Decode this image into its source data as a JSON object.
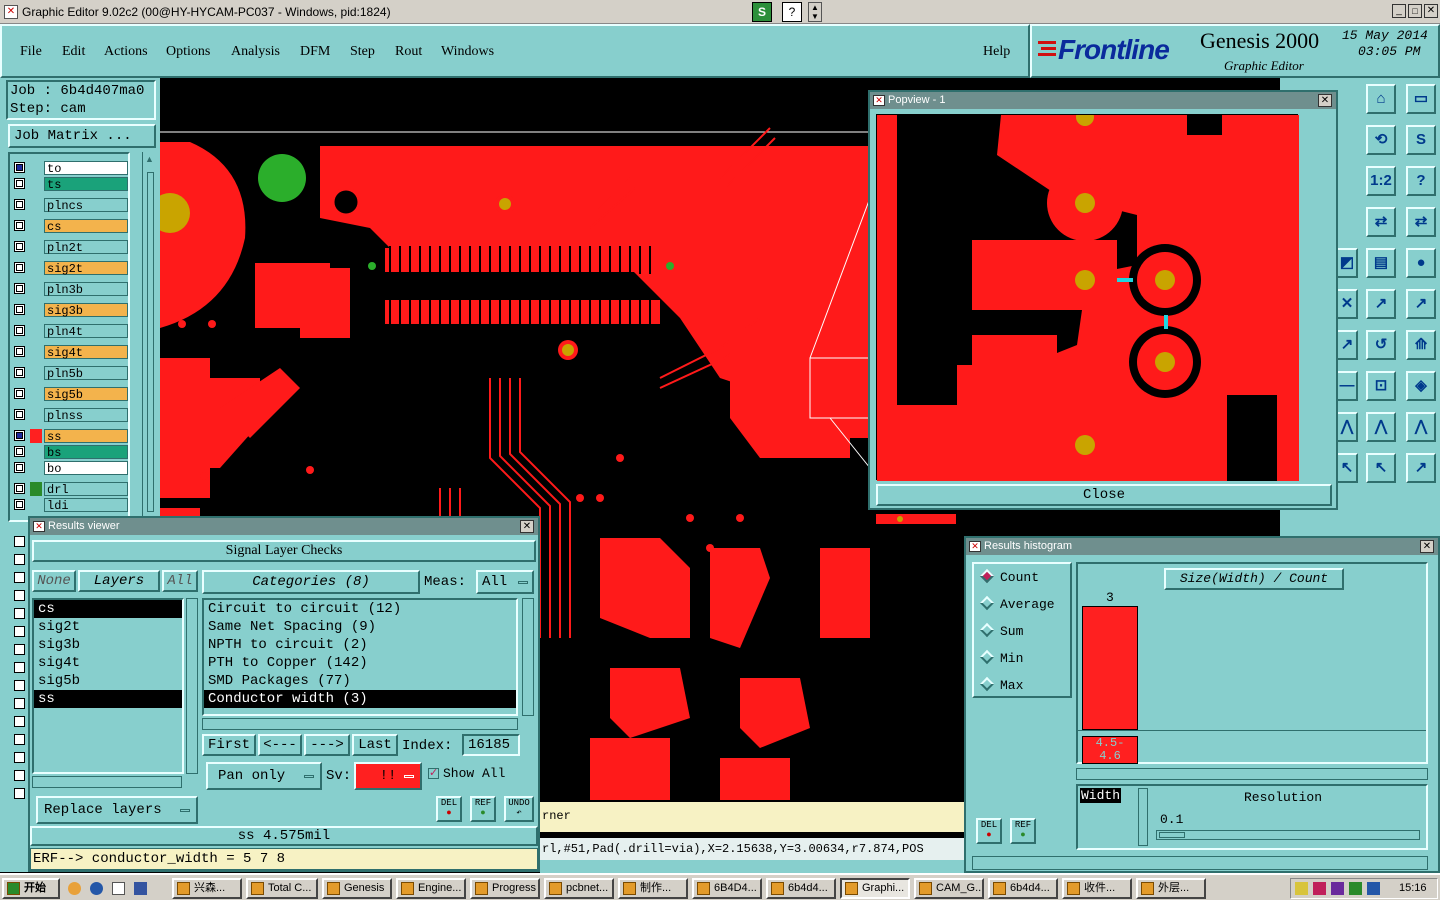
{
  "window": {
    "title": "Graphic Editor 9.02c2 (00@HY-HYCAM-PC037 - Windows, pid:1824)"
  },
  "menu": {
    "items": [
      "File",
      "Edit",
      "Actions",
      "Options",
      "Analysis",
      "DFM",
      "Step",
      "Rout",
      "Windows"
    ],
    "help": "Help"
  },
  "brand": {
    "logo": "Frontline",
    "product": "Genesis 2000",
    "subtitle": "Graphic Editor",
    "date": "15 May 2014",
    "time": "03:05 PM"
  },
  "job": {
    "job_label": "Job  : 6b4d407ma0",
    "step_label": "Step: cam",
    "matrix_button": "Job Matrix ..."
  },
  "layers": [
    {
      "name": "to",
      "color": "#ffffff",
      "checked": true
    },
    {
      "name": "ts",
      "color": "#1aa27a",
      "checked": false
    },
    {
      "name": "plncs",
      "color": "#87cfcd",
      "checked": false
    },
    {
      "name": "cs",
      "color": "#f3b34c",
      "checked": false
    },
    {
      "name": "pln2t",
      "color": "#87cfcd",
      "checked": false
    },
    {
      "name": "sig2t",
      "color": "#f3b34c",
      "checked": false
    },
    {
      "name": "pln3b",
      "color": "#87cfcd",
      "checked": false
    },
    {
      "name": "sig3b",
      "color": "#f3b34c",
      "checked": false
    },
    {
      "name": "pln4t",
      "color": "#87cfcd",
      "checked": false
    },
    {
      "name": "sig4t",
      "color": "#f3b34c",
      "checked": false
    },
    {
      "name": "pln5b",
      "color": "#87cfcd",
      "checked": false
    },
    {
      "name": "sig5b",
      "color": "#f3b34c",
      "checked": false
    },
    {
      "name": "plnss",
      "color": "#87cfcd",
      "checked": false
    },
    {
      "name": "ss",
      "color": "#f3b34c",
      "checked": true
    },
    {
      "name": "bs",
      "color": "#1aa27a",
      "checked": false
    },
    {
      "name": "bo",
      "color": "#ffffff",
      "checked": false
    },
    {
      "name": "drl",
      "color": "#87cfcd",
      "checked": false
    },
    {
      "name": "ldi",
      "color": "#87cfcd",
      "checked": false
    }
  ],
  "popview": {
    "title": "Popview - 1",
    "close": "Close"
  },
  "results_viewer": {
    "title": "Results viewer",
    "heading": "Signal Layer Checks",
    "none": "None",
    "layers_label": "Layers",
    "all": "All",
    "categories_label": "Categories (8)",
    "meas_label": "Meas:",
    "meas_value": "All",
    "layer_list": [
      "cs",
      "sig2t",
      "sig3b",
      "sig4t",
      "sig5b",
      "ss"
    ],
    "categories": [
      "Circuit to circuit (12)",
      "Same Net Spacing (9)",
      "NPTH to circuit (2)",
      "PTH to Copper (142)",
      "SMD Packages (77)",
      "Conductor width (3)"
    ],
    "first": "First",
    "prev": "<---",
    "next": "--->",
    "last": "Last",
    "index_label": "Index:",
    "index_value": "16185",
    "pan_only": "Pan only",
    "sv_label": "Sv:",
    "sv_value": "!!",
    "show_all": "Show All",
    "replace_layers": "Replace layers",
    "del": "DEL",
    "ref": "REF",
    "undo": "UNDO",
    "status_value": "ss 4.575mil",
    "erf": "ERF--> conductor_width = 5 7 8"
  },
  "histogram": {
    "title": "Results histogram",
    "options": [
      "Count",
      "Average",
      "Sum",
      "Min",
      "Max"
    ],
    "selected": "Count",
    "header": "Size(Width) / Count",
    "bar_count": "3",
    "bar_range_top": "4.5-",
    "bar_range_bottom": "4.6",
    "width_label": "Width",
    "resolution_label": "Resolution",
    "resolution_value": "0.1",
    "del": "DEL",
    "ref": "REF"
  },
  "statusline": {
    "corner_text": "rner",
    "info": "rl,#51,Pad(.drill=via),X=2.15638,Y=3.00634,r7.874,POS"
  },
  "taskbar": {
    "start": "开始",
    "tasks": [
      "兴森...",
      "Total C...",
      "Genesis",
      "Engine...",
      "Progress",
      "pcbnet...",
      "制作...",
      "6B4D4...",
      "6b4d4...",
      "Graphi...",
      "CAM_G...",
      "6b4d4...",
      "收件...",
      "外层..."
    ],
    "clock": "15:16"
  },
  "colors": {
    "panel": "#87cfcd",
    "copper": "#ff0000",
    "drill": "#c9a400",
    "title_bar": "#6f8f8e"
  }
}
